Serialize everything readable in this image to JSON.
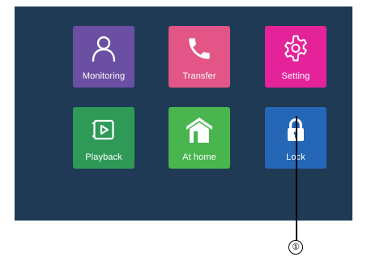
{
  "tiles": {
    "monitoring": {
      "label": "Monitoring",
      "icon": "person-icon",
      "color": "#6a4fa3"
    },
    "transfer": {
      "label": "Transfer",
      "icon": "phone-icon",
      "color": "#e25586"
    },
    "setting": {
      "label": "Setting",
      "icon": "gear-icon",
      "color": "#e4239a"
    },
    "playback": {
      "label": "Playback",
      "icon": "play-screen-icon",
      "color": "#2f9a57"
    },
    "at_home": {
      "label": "At home",
      "icon": "house-icon",
      "color": "#49b54f"
    },
    "lock": {
      "label": "Lock",
      "icon": "padlock-icon",
      "color": "#2567b6"
    }
  },
  "callout": {
    "marker": "①"
  },
  "colors": {
    "background": "#1e3a54"
  }
}
